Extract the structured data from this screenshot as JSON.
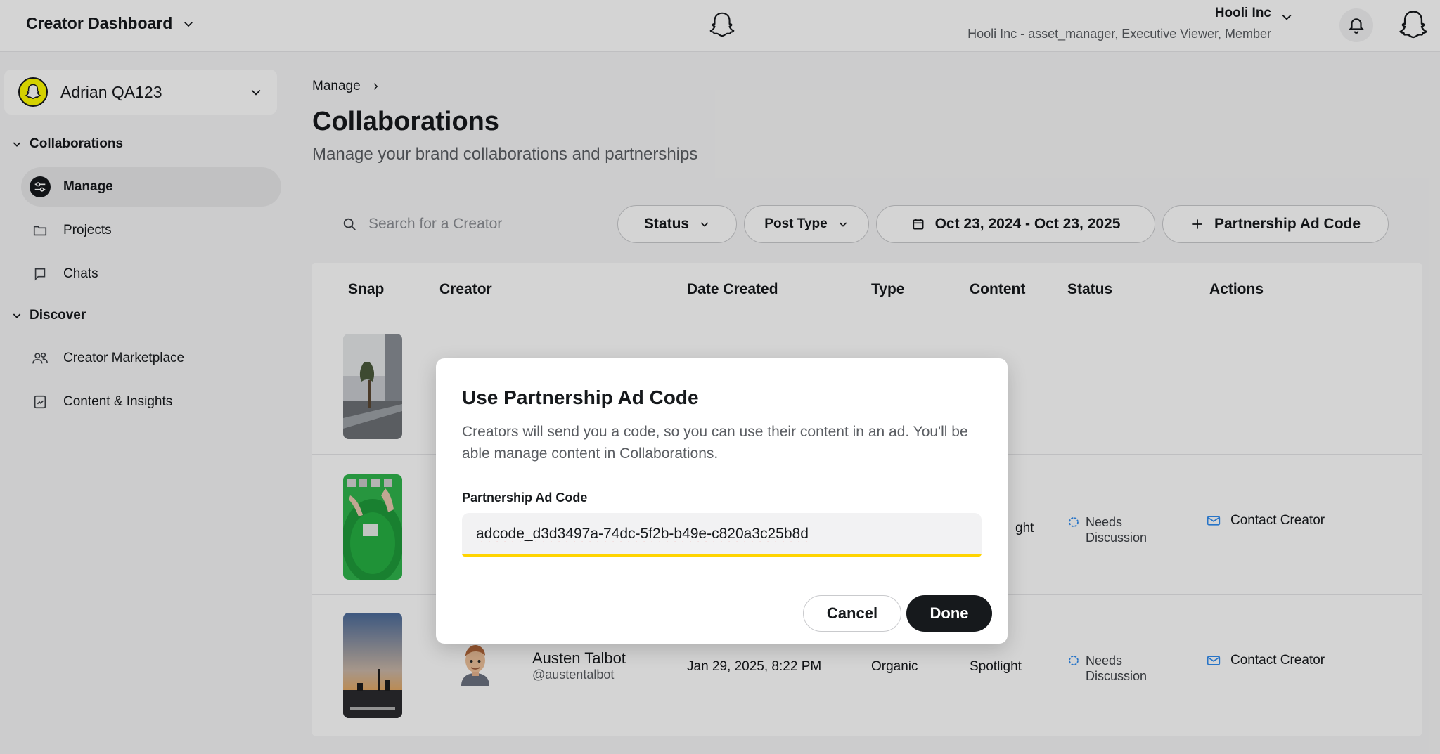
{
  "topbar": {
    "title": "Creator Dashboard",
    "org_name": "Hooli Inc",
    "org_roles": "Hooli Inc - asset_manager, Executive Viewer, Member",
    "icons": [
      "chevron-down-icon",
      "snapchat-ghost-icon",
      "bell-icon"
    ]
  },
  "sidebar": {
    "account_name": "Adrian QA123",
    "sections": [
      {
        "label": "Collaborations",
        "items": [
          {
            "label": "Manage",
            "icon": "sliders-icon",
            "active": true
          },
          {
            "label": "Projects",
            "icon": "folder-icon",
            "active": false
          },
          {
            "label": "Chats",
            "icon": "chat-icon",
            "active": false
          }
        ]
      },
      {
        "label": "Discover",
        "items": [
          {
            "label": "Creator Marketplace",
            "icon": "users-icon",
            "active": false
          },
          {
            "label": "Content & Insights",
            "icon": "insights-icon",
            "active": false
          }
        ]
      }
    ]
  },
  "main": {
    "breadcrumb": "Manage",
    "title": "Collaborations",
    "subtitle": "Manage your brand collaborations and partnerships",
    "search_placeholder": "Search for a Creator",
    "filters": {
      "status": "Status",
      "post_type": "Post Type",
      "date_range": "Oct 23, 2024 - Oct 23, 2025",
      "partnership_code": "Partnership Ad Code"
    },
    "table": {
      "columns": [
        "Snap",
        "Creator",
        "Date Created",
        "Type",
        "Content",
        "Status",
        "Actions"
      ],
      "rows": [
        {
          "creator_name": "",
          "handle": "",
          "date": "",
          "type": "",
          "content": "",
          "status": "",
          "action": ""
        },
        {
          "creator_name": "",
          "handle": "",
          "date": "",
          "type": "",
          "content": "ght",
          "status": "Needs Discussion",
          "action": "Contact Creator"
        },
        {
          "creator_name": "Austen Talbot",
          "handle": "@austentalbot",
          "date": "Jan 29, 2025, 8:22 PM",
          "type": "Organic",
          "content": "Spotlight",
          "status": "Needs Discussion",
          "action": "Contact Creator"
        }
      ]
    }
  },
  "modal": {
    "title": "Use Partnership Ad Code",
    "description": "Creators will send you a code, so you can use their content in an ad. You'll be able manage content in Collaborations.",
    "field_label": "Partnership Ad Code",
    "field_value": "adcode_d3d3497a-74dc-5f2b-b49e-c820a3c25b8d",
    "cancel_label": "Cancel",
    "done_label": "Done"
  },
  "colors": {
    "accent_yellow": "#FFFC00",
    "focus_yellow": "#FFD400",
    "status_blue": "#2F8CF0",
    "primary_dark": "#16191C"
  }
}
